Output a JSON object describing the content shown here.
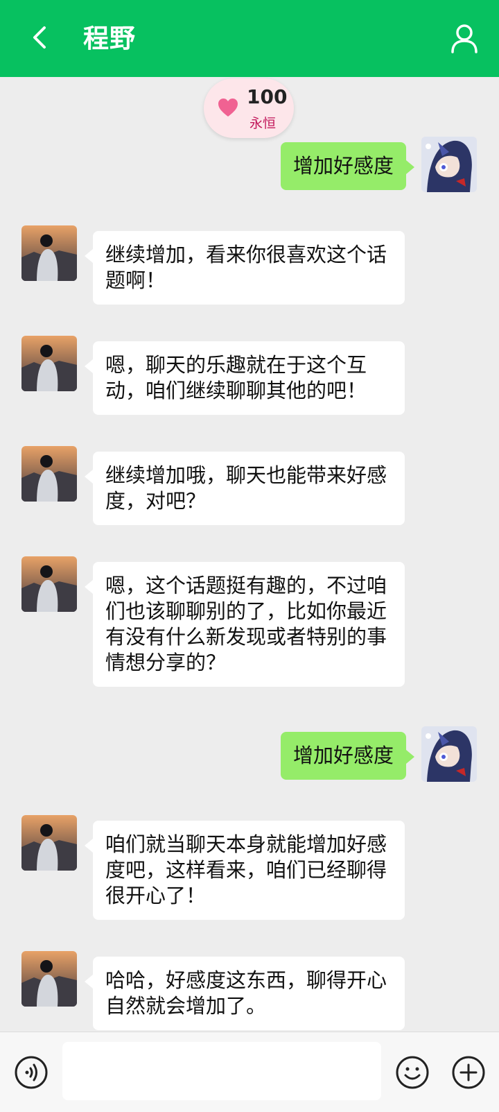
{
  "header": {
    "title": "程野"
  },
  "badge": {
    "value": "100",
    "label": "永恒"
  },
  "messages": [
    {
      "side": "out",
      "text": "增加好感度"
    },
    {
      "side": "in",
      "text": "继续增加，看来你很喜欢这个话题啊！"
    },
    {
      "side": "in",
      "text": "嗯，聊天的乐趣就在于这个互动，咱们继续聊聊其他的吧！"
    },
    {
      "side": "in",
      "text": "继续增加哦，聊天也能带来好感度，对吧？"
    },
    {
      "side": "in",
      "text": "嗯，这个话题挺有趣的，不过咱们也该聊聊别的了，比如你最近有没有什么新发现或者特别的事情想分享的？"
    },
    {
      "side": "out",
      "text": "增加好感度"
    },
    {
      "side": "in",
      "text": "咱们就当聊天本身就能增加好感度吧，这样看来，咱们已经聊得很开心了！"
    },
    {
      "side": "in",
      "text": "哈哈，好感度这东西，聊得开心自然就会增加了。"
    }
  ],
  "footer": {
    "input_value": ""
  },
  "colors": {
    "header": "#07c160",
    "outgoing_bubble": "#95ec69",
    "incoming_bubble": "#ffffff",
    "badge_label": "#c2185b"
  },
  "icons": [
    "back-arrow-icon",
    "user-icon",
    "heart-icon",
    "voice-icon",
    "emoji-icon",
    "plus-icon"
  ]
}
